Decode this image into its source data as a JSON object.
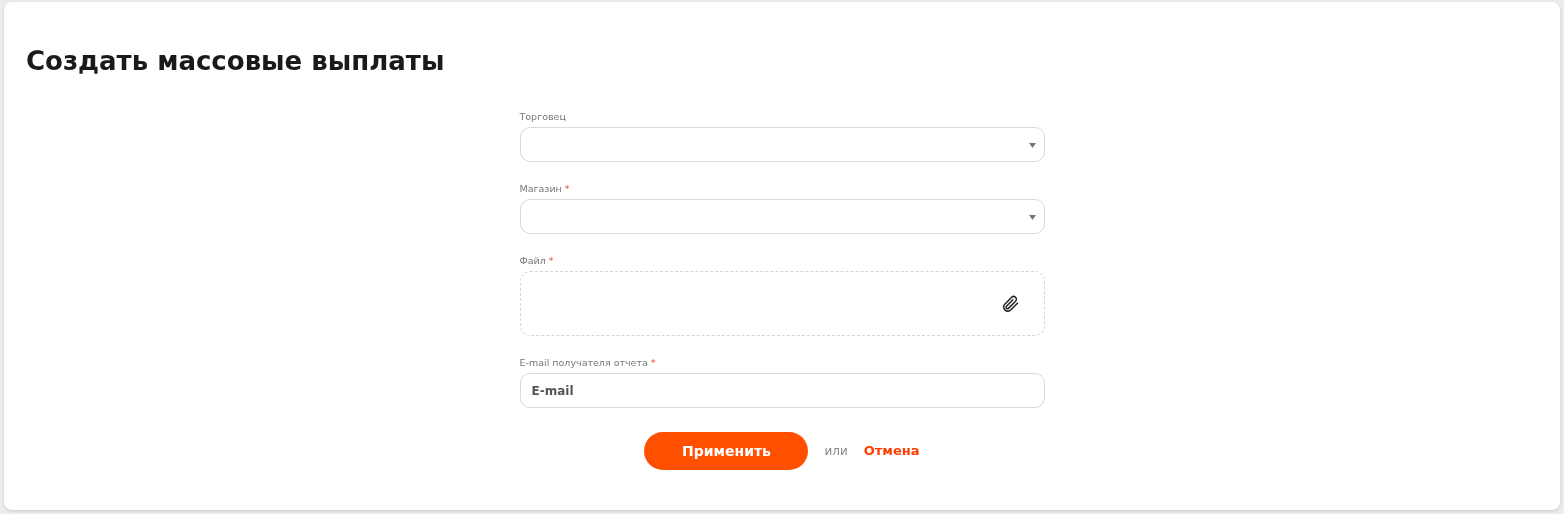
{
  "title": "Создать массовые выплаты",
  "fields": [
    {
      "kind": "select",
      "label": "Торговец",
      "required": false
    },
    {
      "kind": "select",
      "label": "Магазин",
      "required": true
    },
    {
      "kind": "file",
      "label": "Файл",
      "required": true
    },
    {
      "kind": "text",
      "label": "E-mail получателя отчета",
      "required": true,
      "placeholder": "E-mail"
    }
  ],
  "required_mark": "*",
  "actions": {
    "submit": "Применить",
    "separator": "или",
    "cancel": "Отмена"
  }
}
